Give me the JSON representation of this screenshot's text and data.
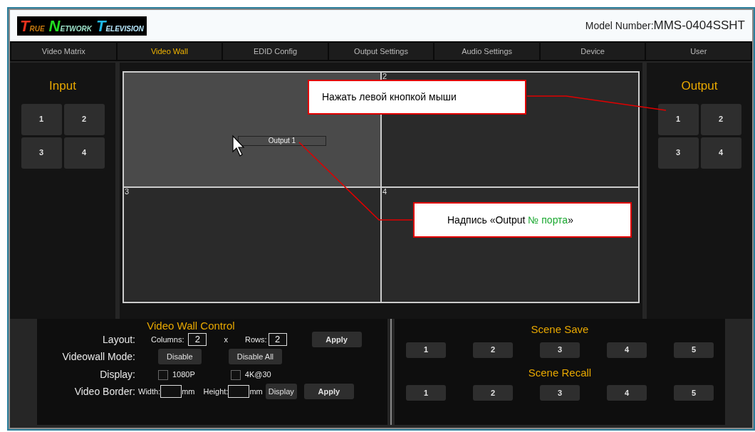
{
  "header": {
    "logo": [
      {
        "initial": "T",
        "rest": "RUE",
        "color": "#e8321e"
      },
      {
        "initial": "N",
        "rest": "ETWORK",
        "color": "#22dd22"
      },
      {
        "initial": "T",
        "rest": "ELEVISION",
        "color": "#1fb8e8"
      }
    ],
    "model_label": "Model Number:",
    "model_value": "MMS-0404SSHT"
  },
  "tabs": [
    {
      "label": "Video Matrix",
      "selected": false
    },
    {
      "label": "Video Wall",
      "selected": true
    },
    {
      "label": "EDID Config",
      "selected": false
    },
    {
      "label": "Output Settings",
      "selected": false
    },
    {
      "label": "Audio Settings",
      "selected": false
    },
    {
      "label": "Device",
      "selected": false
    },
    {
      "label": "User",
      "selected": false
    }
  ],
  "input": {
    "title": "Input",
    "buttons": [
      "1",
      "2",
      "3",
      "4"
    ]
  },
  "output": {
    "title": "Output",
    "buttons": [
      "1",
      "2",
      "3",
      "4"
    ]
  },
  "wall": {
    "cells": [
      {
        "selected": true,
        "tag": "Output 1"
      },
      {
        "label": "2",
        "selected": false
      },
      {
        "label": "3",
        "selected": false
      },
      {
        "label": "4",
        "selected": false
      }
    ]
  },
  "callouts": [
    {
      "parts": [
        {
          "text": "Нажать левой кнопкой мыши",
          "highlight": false
        }
      ]
    },
    {
      "parts": [
        {
          "text": "Надпись «Output ",
          "highlight": false
        },
        {
          "text": "№ порта",
          "highlight": true
        },
        {
          "text": "»",
          "highlight": false
        }
      ]
    }
  ],
  "control": {
    "title": "Video Wall Control",
    "layout_label": "Layout:",
    "columns_label": "Columns:",
    "columns_value": "2",
    "times": "x",
    "rows_label": "Rows:",
    "rows_value": "2",
    "layout_apply": "Apply",
    "mode_label": "Videowall Mode:",
    "mode_buttons": [
      "Disable",
      "Disable All"
    ],
    "display_label": "Display:",
    "display_options": [
      {
        "label": "1080P",
        "checked": false
      },
      {
        "label": "4K@30",
        "checked": false
      }
    ],
    "border_label": "Video Border:",
    "width_label": "Width:",
    "width_unit": "mm",
    "height_label": "Height:",
    "height_unit": "mm",
    "border_display": "Display",
    "border_apply": "Apply"
  },
  "scene_save": {
    "title": "Scene Save",
    "buttons": [
      "1",
      "2",
      "3",
      "4",
      "5"
    ]
  },
  "scene_recall": {
    "title": "Scene Recall",
    "buttons": [
      "1",
      "2",
      "3",
      "4",
      "5"
    ]
  }
}
